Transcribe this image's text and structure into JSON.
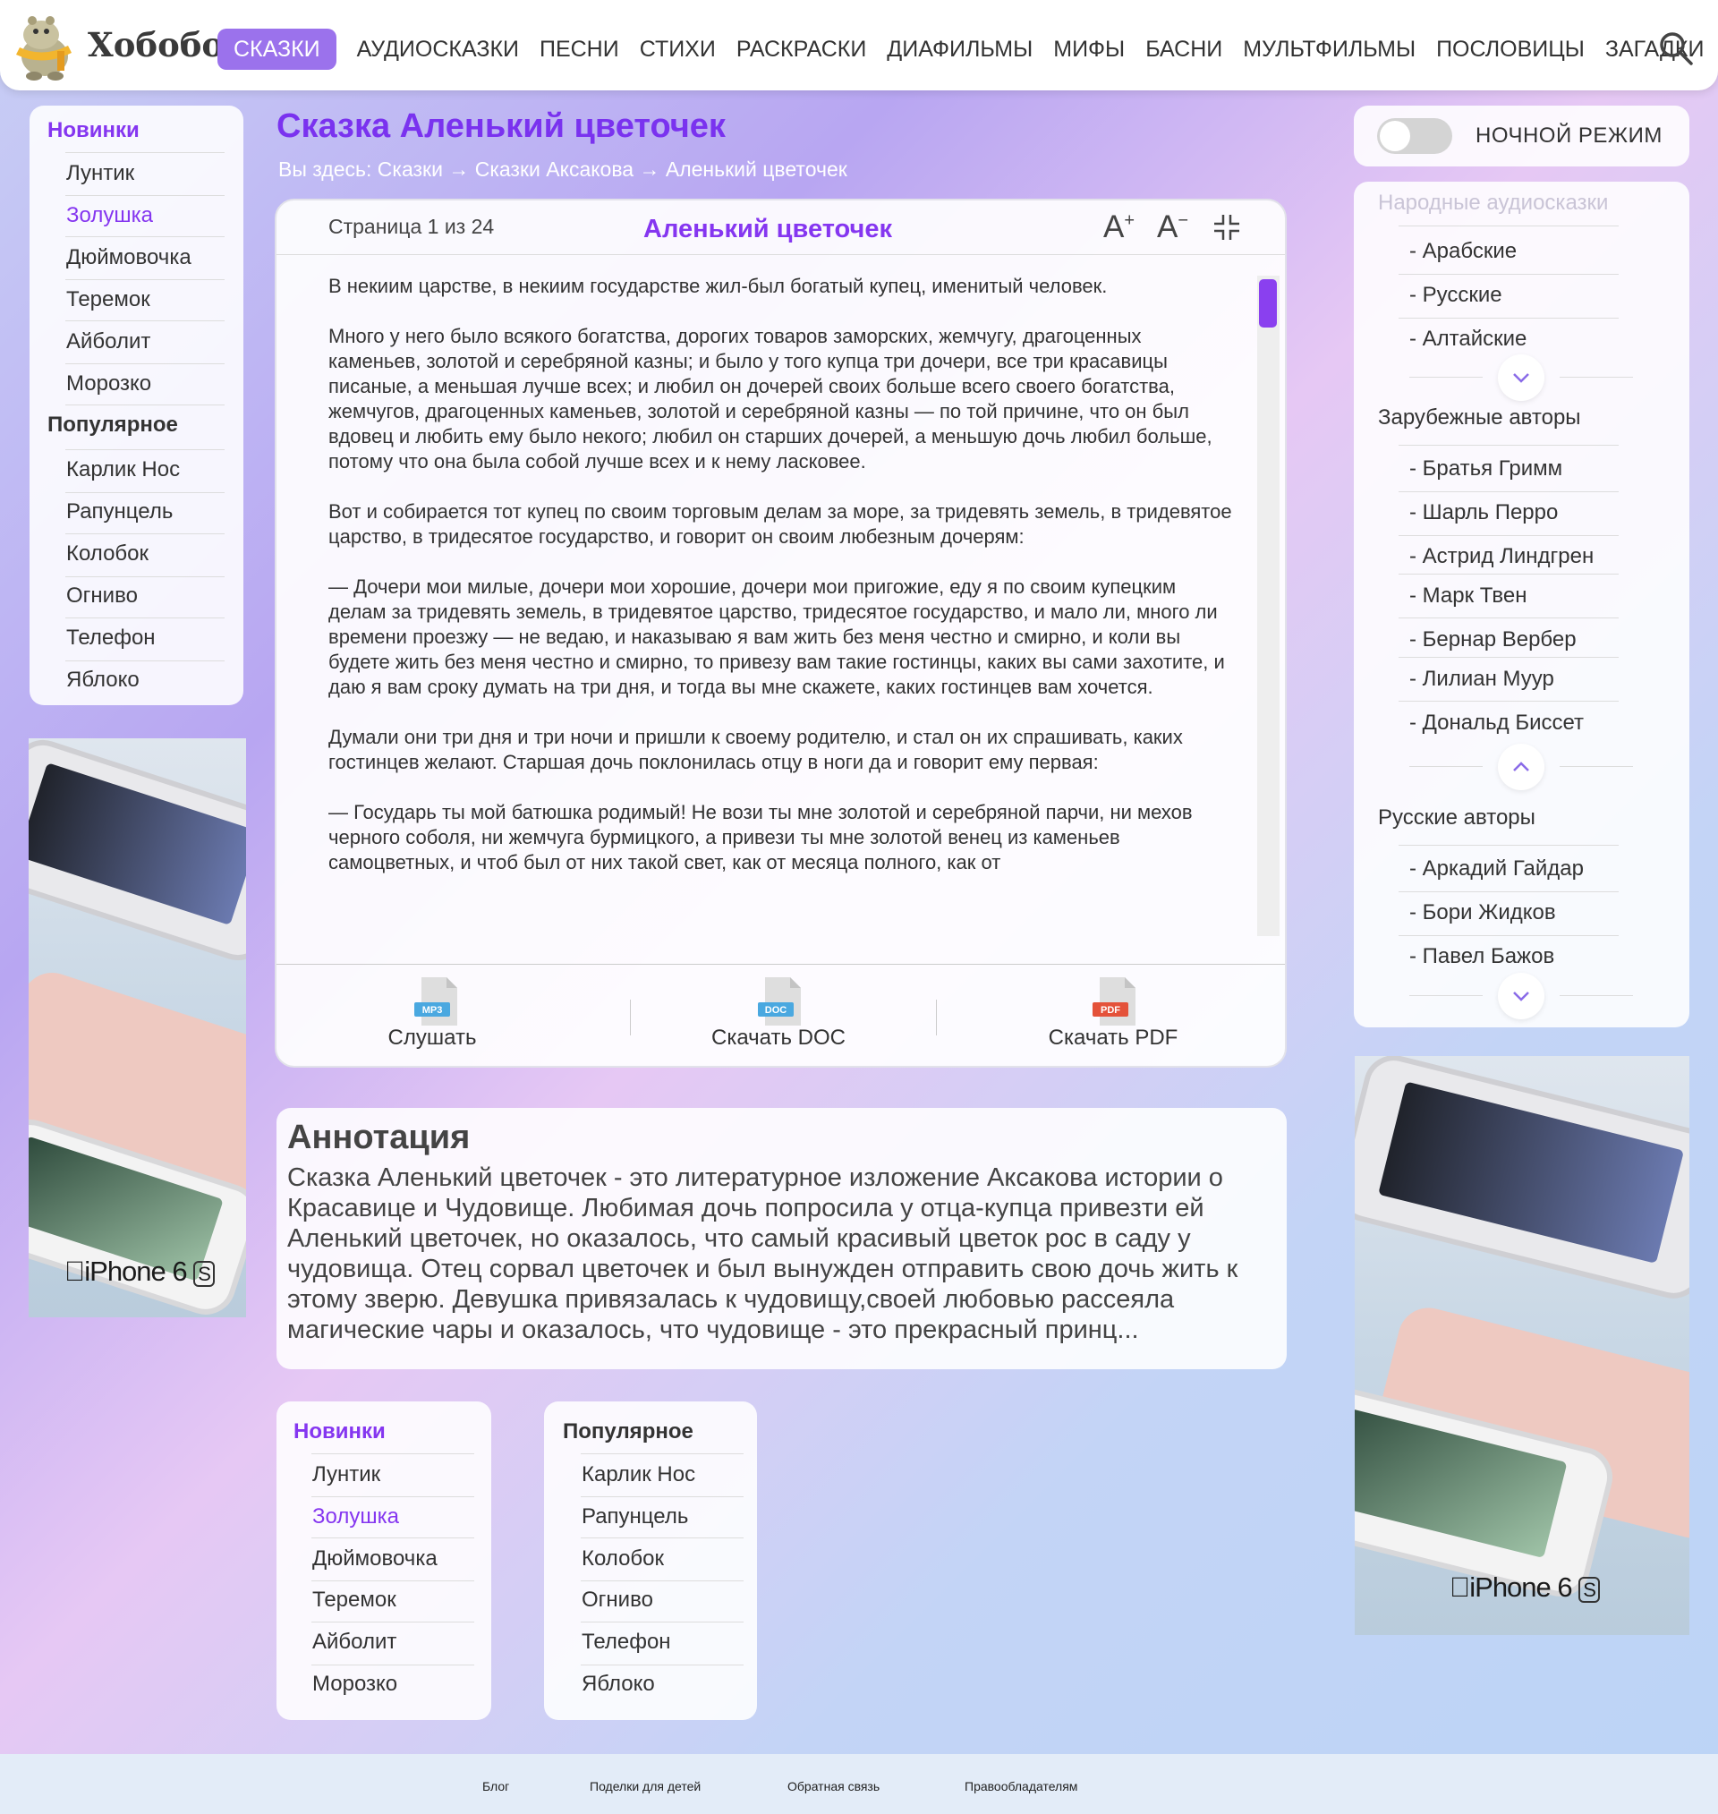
{
  "header": {
    "brand": "Хобобо",
    "nav": [
      "СКАЗКИ",
      "АУДИОСКАЗКИ",
      "ПЕСНИ",
      "СТИХИ",
      "РАСКРАСКИ",
      "ДИАФИЛЬМЫ",
      "МИФЫ",
      "БАСНИ",
      "МУЛЬТФИЛЬМЫ",
      "ПОСЛОВИЦЫ",
      "ЗАГАДКИ"
    ],
    "active_nav": "СКАЗКИ",
    "accent": "#9b72ec"
  },
  "left_menu": {
    "new_title": "Новинки",
    "new_items": [
      "Лунтик",
      "Золушка",
      "Дюймовочка",
      "Теремок",
      "Айболит",
      "Морозко"
    ],
    "popular_title": "Популярное",
    "popular_items": [
      "Карлик Нос",
      "Рапунцель",
      "Колобок",
      "Огниво",
      "Телефон",
      "Яблоко"
    ]
  },
  "ad": {
    "label": "iPhone 6",
    "badge": "S"
  },
  "page": {
    "title": "Сказка Аленький цветочек",
    "breadcrumb": "Вы здесь: Сказки → Сказки Аксакова → Аленький цветочек"
  },
  "reader": {
    "page_info": "Страница 1 из 24",
    "title": "Аленький цветочек",
    "font_up": "A",
    "font_up_sup": "+",
    "font_down": "A",
    "font_down_sup": "−",
    "paragraphs": [
      "В некиим царстве, в некиим государстве жил-был богатый купец, именитый человек.",
      "Много у него было всякого богатства, дорогих товаров заморских, жемчугу, драгоценных каменьев, золотой и серебряной казны; и было у того купца три дочери, все три красавицы писаные, а меньшая лучше всех; и любил он дочерей своих больше всего своего богатства, жемчугов, драгоценных каменьев, золотой и серебряной казны — по той причине, что он был вдовец и любить ему было некого; любил он старших дочерей, а меньшую дочь любил больше, потому что она была собой лучше всех и к нему ласковее.",
      "Вот и собирается тот купец по своим торговым делам за море, за тридевять земель, в тридевятое царство, в тридесятое государство, и говорит он своим любезным дочерям:",
      "— Дочери мои милые, дочери мои хорошие, дочери мои пригожие, еду я по своим купецким делам за тридевять земель, в тридевятое царство, тридесятое государство, и мало ли, много ли времени проезжу — не ведаю, и наказываю я вам жить без меня честно и смирно, и коли вы будете жить без меня честно и смирно, то привезу вам такие гостинцы, каких вы сами захотите, и даю я вам сроку думать на три дня, и тогда вы мне скажете, каких гостинцев вам хочется.",
      "Думали они три дня и три ночи и пришли к своему родителю, и стал он их спрашивать, каких гостинцев желают. Старшая дочь поклонилась отцу в ноги да и говорит ему первая:",
      "— Государь ты мой батюшка родимый! Не вози ты мне золотой и серебряной парчи, ни мехов черного соболя, ни жемчуга бурмицкого, а привези ты мне золотой венец из каменьев самоцветных, и чтоб был от них такой свет, как от месяца полного, как от"
    ],
    "downloads": [
      {
        "label": "Слушать",
        "badge": "MP3",
        "color": "#4aa8e0"
      },
      {
        "label": "Скачать DOC",
        "badge": "DOC",
        "color": "#4aa8e0"
      },
      {
        "label": "Скачать PDF",
        "badge": "PDF",
        "color": "#e4523a"
      }
    ]
  },
  "annotation": {
    "title": "Аннотация",
    "text": "Сказка Аленький цветочек - это литературное изложение Аксакова истории о Красавице  и Чудовище. Любимая дочь попросила у отца-купца привезти ей Аленький цветочек, но оказалось, что самый красивый цветок рос в саду у чудовища. Отец сорвал цветочек и был вынужден отправить свою дочь жить к этому зверю. Девушка привязалась к чудовищу,своей любовью рассеяла магические чары и оказалось, что чудовище - это прекрасный принц..."
  },
  "night_mode": {
    "label": "НОЧНОЙ РЕЖИМ"
  },
  "right_menu": {
    "folk_title": "Народные аудиосказки",
    "folk_items": [
      "- Арабские",
      "- Русские",
      "- Алтайские"
    ],
    "foreign_title": "Зарубежные авторы",
    "foreign_items": [
      "- Братья Гримм",
      "- Шарль Перро",
      "- Астрид Линдгрен",
      "- Марк Твен",
      "- Бернар Вербер",
      "- Лилиан Муур",
      "- Дональд Биссет"
    ],
    "russian_title": "Русские авторы",
    "russian_items": [
      "- Аркадий Гайдар",
      "- Бори Жидков",
      "- Павел Бажов"
    ]
  },
  "footer": {
    "links": [
      "Блог",
      "Поделки для детей",
      "Обратная связь",
      "Правообладателям"
    ]
  },
  "colors": {
    "title_purple": "#7a32ef",
    "highlight": "#8a40ef"
  }
}
